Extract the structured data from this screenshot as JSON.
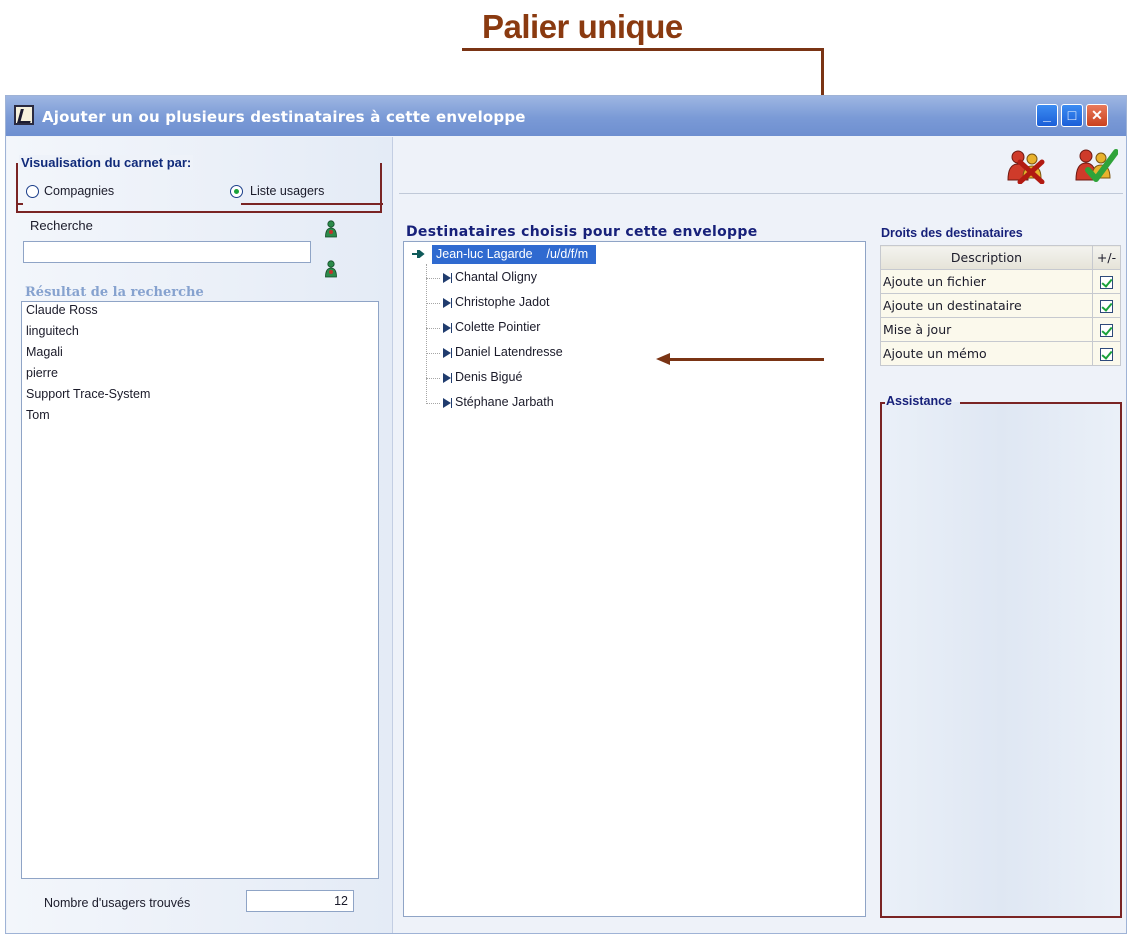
{
  "annotation": {
    "title": "Palier unique"
  },
  "window": {
    "title": "Ajouter un ou plusieurs destinataires à cette enveloppe",
    "controls": {
      "minimize": "_",
      "maximize": "□",
      "close": "✕"
    }
  },
  "left": {
    "group_label": "Visualisation du carnet par:",
    "options": {
      "companies": "Compagnies",
      "users": "Liste usagers",
      "selected": "Liste usagers"
    },
    "search_label": "Recherche",
    "search_value": "",
    "results_label": "Résultat de la recherche",
    "results": [
      "Claude Ross",
      "linguitech",
      "Magali",
      "pierre",
      "Support Trace-System",
      "Tom"
    ],
    "count_label": "Nombre d'usagers trouvés",
    "count_value": "12"
  },
  "center": {
    "label": "Destinataires choisis pour cette enveloppe",
    "root": {
      "name": "Jean-luc Lagarde",
      "rights": "/u/d/f/m",
      "display": "Jean-luc Lagarde    /u/d/f/m"
    },
    "children": [
      "Chantal Oligny",
      "Christophe Jadot",
      "Colette Pointier",
      "Daniel Latendresse",
      "Denis Bigué",
      "Stéphane Jarbath"
    ]
  },
  "right": {
    "rights_label": "Droits des destinataires",
    "table_headers": {
      "description": "Description",
      "toggle": "+/-"
    },
    "rights": [
      {
        "label": "Ajoute un fichier",
        "checked": true
      },
      {
        "label": "Ajoute un destinataire",
        "checked": true
      },
      {
        "label": "Mise à jour",
        "checked": true
      },
      {
        "label": "Ajoute un mémo",
        "checked": true
      }
    ],
    "assist_label": "Assistance"
  },
  "toolbar": {
    "cancel_icon": "cancel-users-icon",
    "confirm_icon": "confirm-users-icon"
  },
  "colors": {
    "annotation": "#7a3414",
    "selection": "#2f6ad0",
    "group_border": "#7a2424",
    "heading_blue": "#17217a"
  }
}
